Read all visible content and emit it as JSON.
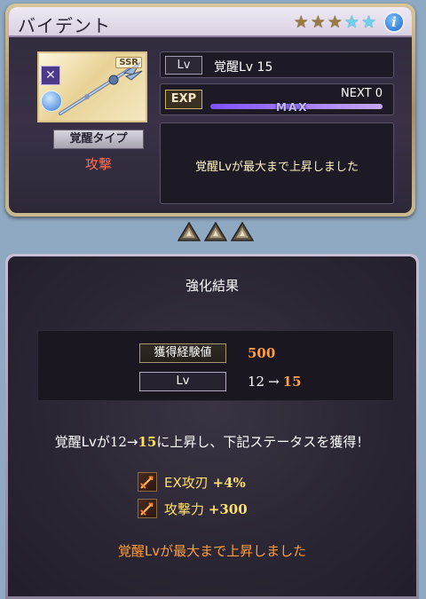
{
  "weapon": {
    "name": "バイデント",
    "rarity_badge": "SSR",
    "stars": [
      {
        "type": "gold",
        "glyph": "★"
      },
      {
        "type": "gold",
        "glyph": "★"
      },
      {
        "type": "gold",
        "glyph": "★"
      },
      {
        "type": "blue",
        "glyph": "★"
      },
      {
        "type": "blue",
        "glyph": "★"
      }
    ],
    "info_icon_label": "i",
    "element_icon": "dark-element-icon",
    "awaken_type_label": "覚醒タイプ",
    "awaken_type_value": "攻撃",
    "lv_tag": "Lv",
    "lv_value": "覚醒Lv 15",
    "exp_tag": "EXP",
    "next_label": "NEXT 0",
    "exp_progress": 1.0,
    "max_label": "MAX",
    "message": "覚醒Lvが最大まで上昇しました"
  },
  "result": {
    "title": "強化結果",
    "gain_label": "獲得経験値",
    "gain_value": "500",
    "lv_label": "Lv",
    "lv_from": "12",
    "lv_arrow": "→",
    "lv_to": "15",
    "summary": {
      "prefix": "覚醒Lvが",
      "from": "12",
      "arrow": "→",
      "to": "15",
      "suffix": "に上昇し、下記ステータスを獲得！"
    },
    "stats": [
      {
        "label": "EX攻刃",
        "value": "+4%"
      },
      {
        "label": "攻撃力",
        "value": "+300"
      }
    ],
    "max_message": "覚醒Lvが最大まで上昇しました"
  },
  "colors": {
    "accent_orange": "#ff9e3d",
    "highlight_yellow": "#ffe05a",
    "attack_red": "#ff6f4d",
    "exp_purple": "#7b52ff"
  }
}
